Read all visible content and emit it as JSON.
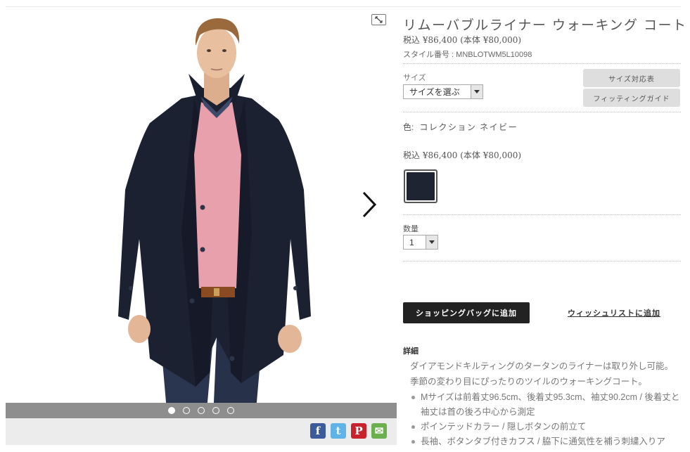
{
  "product": {
    "title": "リムーバブルライナー ウォーキング コート",
    "price": "税込 ¥86,400 (本体 ¥80,000)",
    "style_no": "スタイル番号 : MNBLOTWM5L10098"
  },
  "size": {
    "label": "サイズ",
    "select_value": "サイズを選ぶ",
    "size_chart_button": "サイズ対応表",
    "fitting_guide_button": "フィッティングガイド"
  },
  "color": {
    "label": "色:",
    "value": "コレクション ネイビー",
    "price": "税込 ¥86,400 (本体 ¥80,000)",
    "swatch_color": "#1f2433"
  },
  "quantity": {
    "label": "数量",
    "value": "1"
  },
  "actions": {
    "add_to_bag": "ショッピングバッグに追加",
    "wishlist": "ウィッシュリストに追加"
  },
  "details": {
    "heading": "詳細",
    "description": "ダイアモンドキルティングのタータンのライナーは取り外し可能。季節の変わり目にぴったりのツイルのウォーキングコート。",
    "bullets": [
      "Mサイズは前着丈96.5cm、後着丈95.3cm、袖丈90.2cm / 後着丈と袖丈は首の後ろ中心から測定",
      "ポインテッドカラー / 隠しボタンの前立て",
      "長袖、ボタンタブ付きカフス / 脇下に通気性を補う刺繍入りア"
    ]
  },
  "gallery": {
    "image_count": 5,
    "active_index": 0,
    "share": [
      "facebook-icon",
      "twitter-icon",
      "pinterest-icon",
      "email-icon"
    ],
    "share_glyphs": {
      "facebook": "f",
      "twitter": "t",
      "pinterest": "P",
      "email": "✉"
    },
    "colors": {
      "coat": "#1c2132",
      "sweater": "#e9a0ad",
      "skin": "#e8bf9f",
      "hair": "#9a6a3c",
      "jeans": "#2a3550",
      "belt": "#8a4a22"
    }
  }
}
